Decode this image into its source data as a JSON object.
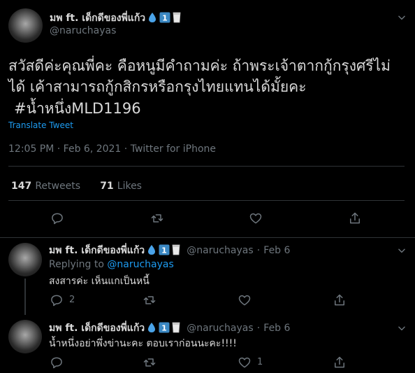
{
  "main_tweet": {
    "display_name": "มพ ft. เด็กดีของพี่แก้ว",
    "handle": "@naruchayas",
    "text_line1": "สวัสดีค่ะคุณพี่คะ คือหนูมีคำถามค่ะ ถ้าพระเจ้าตากกู้กรุงศรีไม่",
    "text_line2": "ได้ เค้าสามารถกู้กสิกรหรือกรุงไทยแทนได้มั้ยคะ",
    "hashtag": "#น้ำหนึ่งMLD1196",
    "translate_label": "Translate Tweet",
    "timestamp": "12:05 PM · Feb 6, 2021 · Twitter for iPhone",
    "retweets_count": "147",
    "retweets_label": "Retweets",
    "likes_count": "71",
    "likes_label": "Likes"
  },
  "replies": [
    {
      "display_name": "มพ ft. เด็กดีของพี่แก้ว",
      "handle": "@naruchayas",
      "separator": "·",
      "date": "Feb 6",
      "replying_to_label": "Replying to",
      "replying_to_handle": "@naruchayas",
      "text": "สงสารค่ะ เห็นแกเป็นหนี้",
      "reply_count": "2",
      "retweet_count": "",
      "like_count": ""
    },
    {
      "display_name": "มพ ft. เด็กดีของพี่แก้ว",
      "handle": "@naruchayas",
      "separator": "·",
      "date": "Feb 6",
      "text": "น้ำหนึ่งอย่าพึ่งข่านะคะ ตอบเราก่อนนะคะ!!!!",
      "reply_count": "",
      "retweet_count": "",
      "like_count": "1"
    }
  ],
  "icons": {
    "badge": [
      "droplet-icon",
      "keycap-one-icon",
      "milk-glass-icon"
    ],
    "actions": [
      "reply-icon",
      "retweet-icon",
      "like-icon",
      "share-icon"
    ],
    "menu": "caret-down-icon"
  },
  "colors": {
    "background": "#000000",
    "text": "#d9d9d9",
    "muted": "#6e767d",
    "accent": "#1d9bf0",
    "divider": "#2f3336"
  }
}
